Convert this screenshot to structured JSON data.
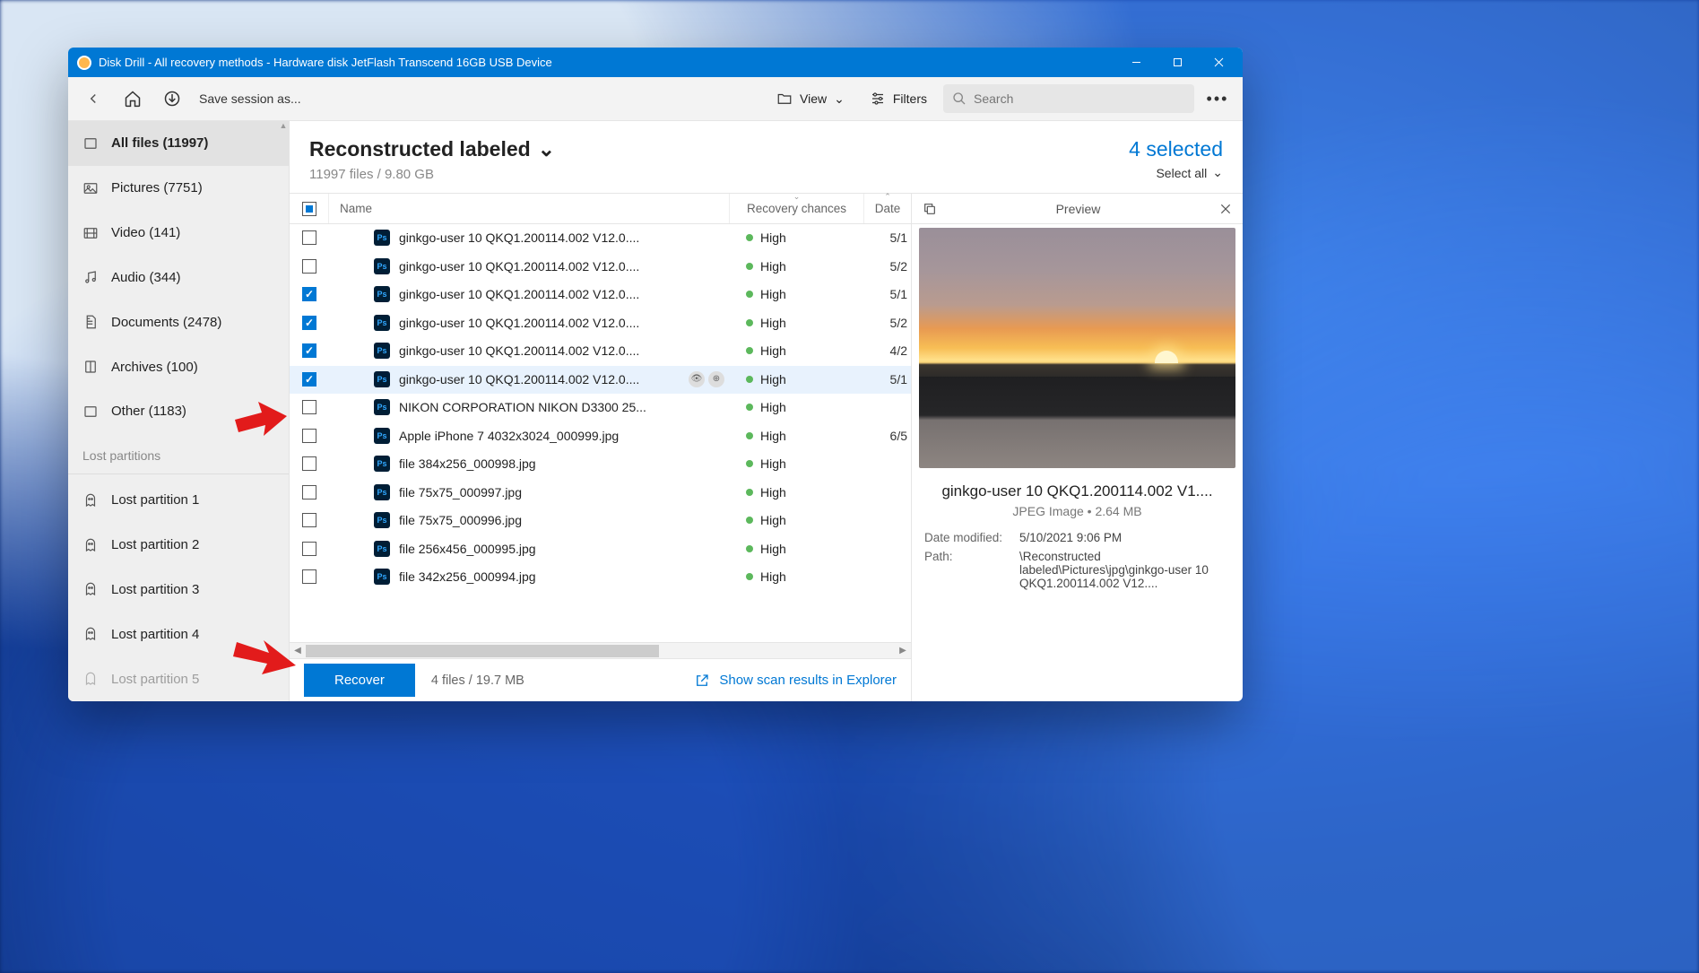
{
  "window": {
    "title": "Disk Drill - All recovery methods - Hardware disk JetFlash Transcend 16GB USB Device"
  },
  "toolbar": {
    "save_session": "Save session as...",
    "view": "View",
    "filters": "Filters",
    "search_placeholder": "Search"
  },
  "sidebar": {
    "categories": [
      {
        "label": "All files (11997)",
        "icon": "all"
      },
      {
        "label": "Pictures (7751)",
        "icon": "pictures"
      },
      {
        "label": "Video (141)",
        "icon": "video"
      },
      {
        "label": "Audio (344)",
        "icon": "audio"
      },
      {
        "label": "Documents (2478)",
        "icon": "documents"
      },
      {
        "label": "Archives (100)",
        "icon": "archives"
      },
      {
        "label": "Other (1183)",
        "icon": "other"
      }
    ],
    "lost_header": "Lost partitions",
    "lost_partitions": [
      {
        "label": "Lost partition 1"
      },
      {
        "label": "Lost partition 2"
      },
      {
        "label": "Lost partition 3"
      },
      {
        "label": "Lost partition 4"
      },
      {
        "label": "Lost partition 5"
      }
    ]
  },
  "header": {
    "title": "Reconstructed labeled",
    "subtitle": "11997 files / 9.80 GB",
    "selected": "4 selected",
    "select_all": "Select all"
  },
  "columns": {
    "name": "Name",
    "recovery": "Recovery chances",
    "date": "Date"
  },
  "rows": [
    {
      "checked": false,
      "name": "ginkgo-user 10 QKQ1.200114.002 V12.0....",
      "recovery": "High",
      "date": "5/1"
    },
    {
      "checked": false,
      "name": "ginkgo-user 10 QKQ1.200114.002 V12.0....",
      "recovery": "High",
      "date": "5/2"
    },
    {
      "checked": true,
      "name": "ginkgo-user 10 QKQ1.200114.002 V12.0....",
      "recovery": "High",
      "date": "5/1"
    },
    {
      "checked": true,
      "name": "ginkgo-user 10 QKQ1.200114.002 V12.0....",
      "recovery": "High",
      "date": "5/2"
    },
    {
      "checked": true,
      "name": "ginkgo-user 10 QKQ1.200114.002 V12.0....",
      "recovery": "High",
      "date": "4/2"
    },
    {
      "checked": true,
      "name": "ginkgo-user 10 QKQ1.200114.002 V12.0....",
      "recovery": "High",
      "date": "5/1",
      "active": true
    },
    {
      "checked": false,
      "name": "NIKON CORPORATION NIKON D3300 25...",
      "recovery": "High",
      "date": ""
    },
    {
      "checked": false,
      "name": "Apple iPhone 7 4032x3024_000999.jpg",
      "recovery": "High",
      "date": "6/5"
    },
    {
      "checked": false,
      "name": "file 384x256_000998.jpg",
      "recovery": "High",
      "date": ""
    },
    {
      "checked": false,
      "name": "file 75x75_000997.jpg",
      "recovery": "High",
      "date": ""
    },
    {
      "checked": false,
      "name": "file 75x75_000996.jpg",
      "recovery": "High",
      "date": ""
    },
    {
      "checked": false,
      "name": "file 256x456_000995.jpg",
      "recovery": "High",
      "date": ""
    },
    {
      "checked": false,
      "name": "file 342x256_000994.jpg",
      "recovery": "High",
      "date": ""
    }
  ],
  "footer": {
    "recover": "Recover",
    "summary": "4 files / 19.7 MB",
    "scan_link": "Show scan results in Explorer"
  },
  "preview": {
    "title": "Preview",
    "filename": "ginkgo-user 10 QKQ1.200114.002 V1....",
    "meta": "JPEG Image • 2.64 MB",
    "details": [
      {
        "k": "Date modified:",
        "v": "5/10/2021 9:06 PM"
      },
      {
        "k": "Path:",
        "v": "\\Reconstructed labeled\\Pictures\\jpg\\ginkgo-user 10 QKQ1.200114.002 V12...."
      }
    ]
  }
}
